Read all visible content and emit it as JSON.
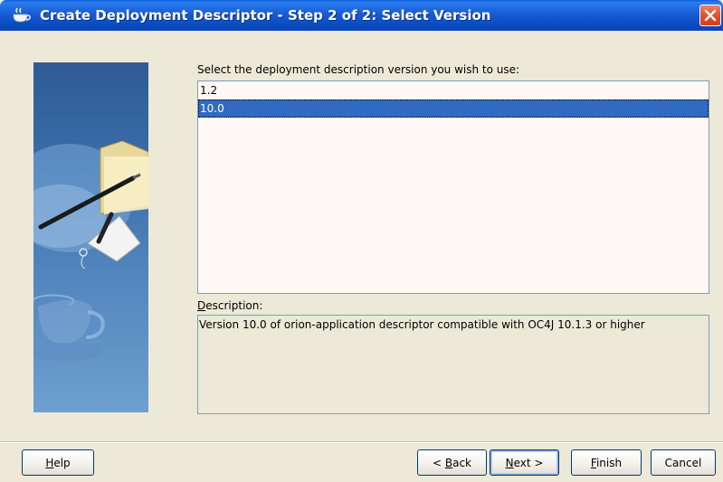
{
  "window": {
    "title": "Create Deployment Descriptor - Step 2 of 2: Select Version"
  },
  "main": {
    "prompt": "Select the deployment description version you wish to use:",
    "versions": [
      {
        "label": "1.2",
        "selected": false
      },
      {
        "label": "10.0",
        "selected": true
      }
    ],
    "description_label_mnemonic": "D",
    "description_label_rest": "escription:",
    "description_text": "Version 10.0 of orion-application descriptor compatible with OC4J 10.1.3 or higher"
  },
  "buttons": {
    "help": {
      "mnemonic": "H",
      "rest": "elp"
    },
    "back": {
      "prefix": "< ",
      "mnemonic": "B",
      "rest": "ack"
    },
    "next": {
      "mnemonic": "N",
      "rest": "ext >"
    },
    "finish": {
      "mnemonic": "F",
      "rest": "inish"
    },
    "cancel": {
      "label": "Cancel"
    }
  },
  "colors": {
    "titlebar": "#0a5fd8",
    "selection": "#316ac5",
    "dialog_bg": "#ece9d8",
    "list_bg": "#fff8f4",
    "close_button": "#e2542c"
  },
  "icons": {
    "title": "coffee-cup-icon",
    "close": "close-icon",
    "banner": "wizard-banner-graphic"
  }
}
